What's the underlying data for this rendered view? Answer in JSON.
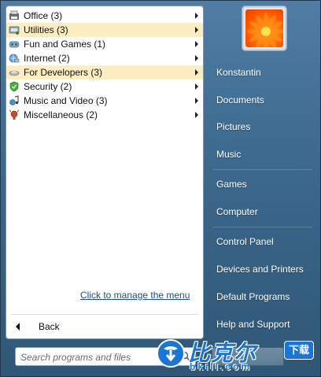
{
  "programs": [
    {
      "label": "Office (3)",
      "icon": "office-icon",
      "highlighted": false
    },
    {
      "label": "Utilities (3)",
      "icon": "utilities-icon",
      "highlighted": true
    },
    {
      "label": "Fun and Games (1)",
      "icon": "games-icon",
      "highlighted": false
    },
    {
      "label": "Internet (2)",
      "icon": "internet-icon",
      "highlighted": false
    },
    {
      "label": "For Developers (3)",
      "icon": "developers-icon",
      "highlighted": true
    },
    {
      "label": "Security (2)",
      "icon": "shield-icon",
      "highlighted": false
    },
    {
      "label": "Music and Video (3)",
      "icon": "music-icon",
      "highlighted": false
    },
    {
      "label": "Miscellaneous (2)",
      "icon": "misc-icon",
      "highlighted": false
    }
  ],
  "manage_link": "Click to manage the menu",
  "back_label": "Back",
  "search": {
    "placeholder": "Search programs and files",
    "value": ""
  },
  "right_items": [
    {
      "label": "Konstantin"
    },
    {
      "label": "Documents"
    },
    {
      "label": "Pictures"
    },
    {
      "label": "Music"
    },
    {
      "label": "Games"
    },
    {
      "label": "Computer"
    },
    {
      "label": "Control Panel"
    },
    {
      "label": "Devices and Printers"
    },
    {
      "label": "Default Programs"
    },
    {
      "label": "Help and Support"
    }
  ],
  "watermark": {
    "text": "比克尔",
    "badge": "下载",
    "url": "bkill.com"
  },
  "colors": {
    "highlight": "#fbecc2",
    "link": "#1b4f8a",
    "right_pane": "#3d6a8f"
  }
}
